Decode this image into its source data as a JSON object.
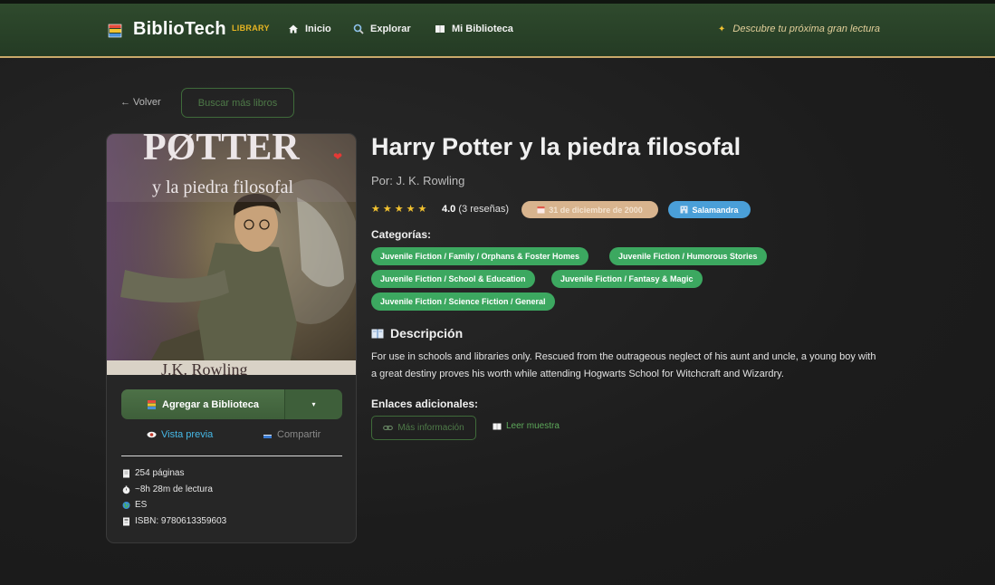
{
  "nav": {
    "brand": "BiblioTech",
    "badge": "LIBRARY",
    "links": [
      "Inicio",
      "Explorar",
      "Mi Biblioteca"
    ],
    "tagline": "Descubre tu próxima gran lectura"
  },
  "toolbar": {
    "back": "← Volver",
    "search_more": "Buscar más libros"
  },
  "cover": {
    "title_text": "PØTTER",
    "subtitle_text": "y la piedra filosofal",
    "author_text": "J.K. Rowling"
  },
  "book": {
    "title": "Harry Potter y la piedra filosofal",
    "author": "Por: J. K. Rowling",
    "stars": "★★★★★",
    "rating": "4.0",
    "reviews": "(3 reseñas)",
    "date": "31 de diciembre de 2000",
    "publisher": "Salamandra",
    "categories_label": "Categorías:",
    "categories": [
      "Juvenile Fiction / Family / Orphans & Foster Homes",
      "Juvenile Fiction / Humorous Stories",
      "Juvenile Fiction / School & Education",
      "Juvenile Fiction / Fantasy & Magic",
      "Juvenile Fiction / Science Fiction / General"
    ],
    "description_label": "Descripción",
    "description": "For use in schools and libraries only. Rescued from the outrageous neglect of his aunt and uncle, a young boy with a great destiny proves his worth while attending Hogwarts School for Witchcraft and Wizardry.",
    "links_label": "Enlaces adicionales:",
    "more_info": "Más información",
    "read_sample": "Leer muestra"
  },
  "sidebar": {
    "add_button": "Agregar a Biblioteca",
    "dropdown_caret": "▾",
    "preview": "Vista previa",
    "share": "Compartir",
    "pages": "254 páginas",
    "reading_time": "~8h 28m de lectura",
    "language": "ES",
    "isbn": "ISBN: 9780613359603"
  },
  "colors": {
    "navbar": "#2f4a2d",
    "accent_gold": "#c9a96a",
    "chip_green": "#3ca860",
    "publisher_blue": "#4a9fd8",
    "date_tan": "#d8b48e",
    "preview_blue": "#46b8e6"
  }
}
